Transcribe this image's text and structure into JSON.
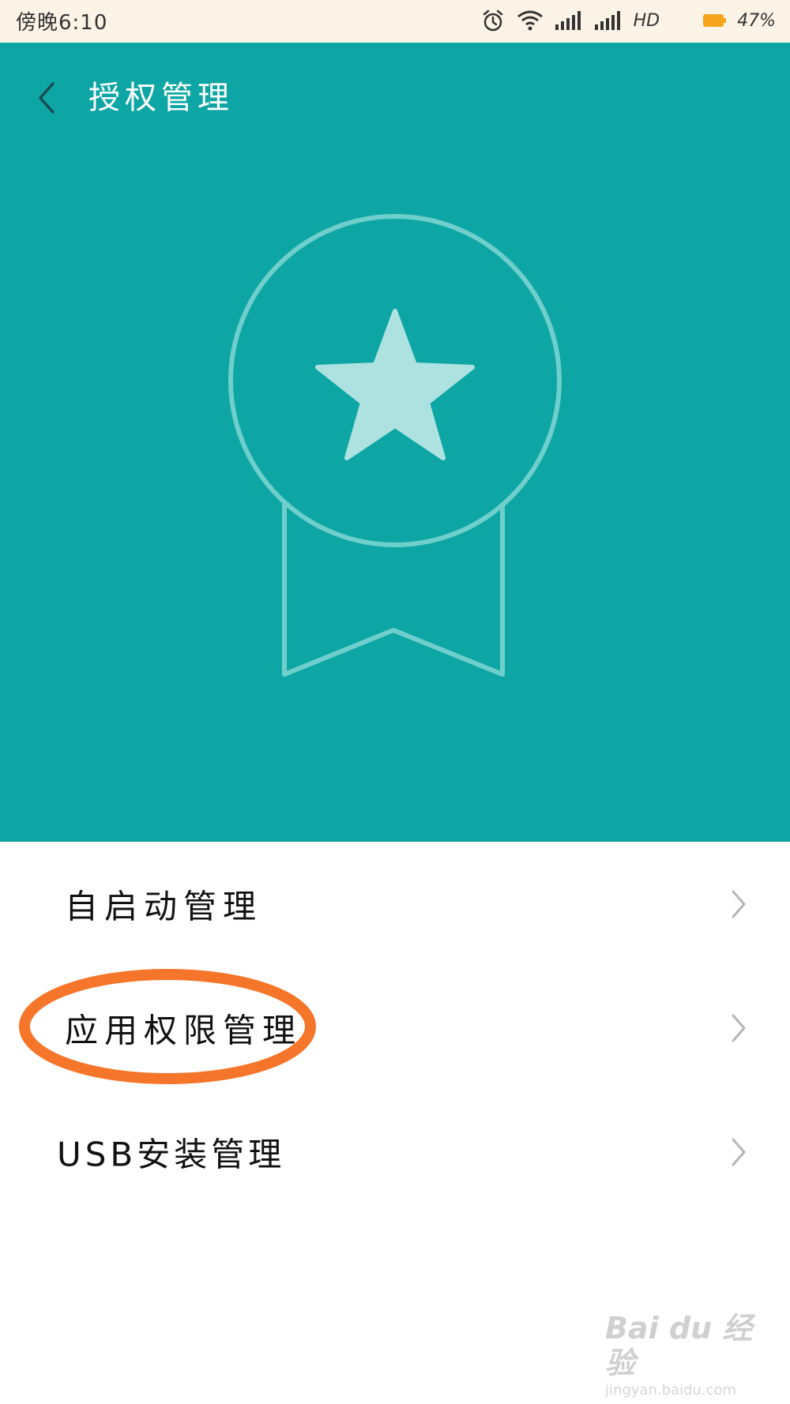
{
  "status_bar": {
    "time": "傍晚6:10",
    "network_label": "HD",
    "battery_percent": "47%",
    "icons": [
      "alarm-icon",
      "wifi-icon",
      "signal-icon",
      "signal-icon",
      "battery-icon"
    ],
    "battery_color": "#f7a41d"
  },
  "header": {
    "title": "授权管理",
    "background_color": "#0ea6a4",
    "back_icon": "chevron-left-icon",
    "badge_icon": "medal-star-icon"
  },
  "menu": {
    "items": [
      {
        "label": "自启动管理",
        "icon": "chevron-right-icon"
      },
      {
        "label": "应用权限管理",
        "icon": "chevron-right-icon",
        "highlighted": true
      },
      {
        "label": "USB安装管理",
        "icon": "chevron-right-icon"
      }
    ],
    "highlight_color": "#f5762a"
  },
  "watermark": {
    "brand": "Bai du 经验",
    "url": "jingyan.baidu.com"
  }
}
